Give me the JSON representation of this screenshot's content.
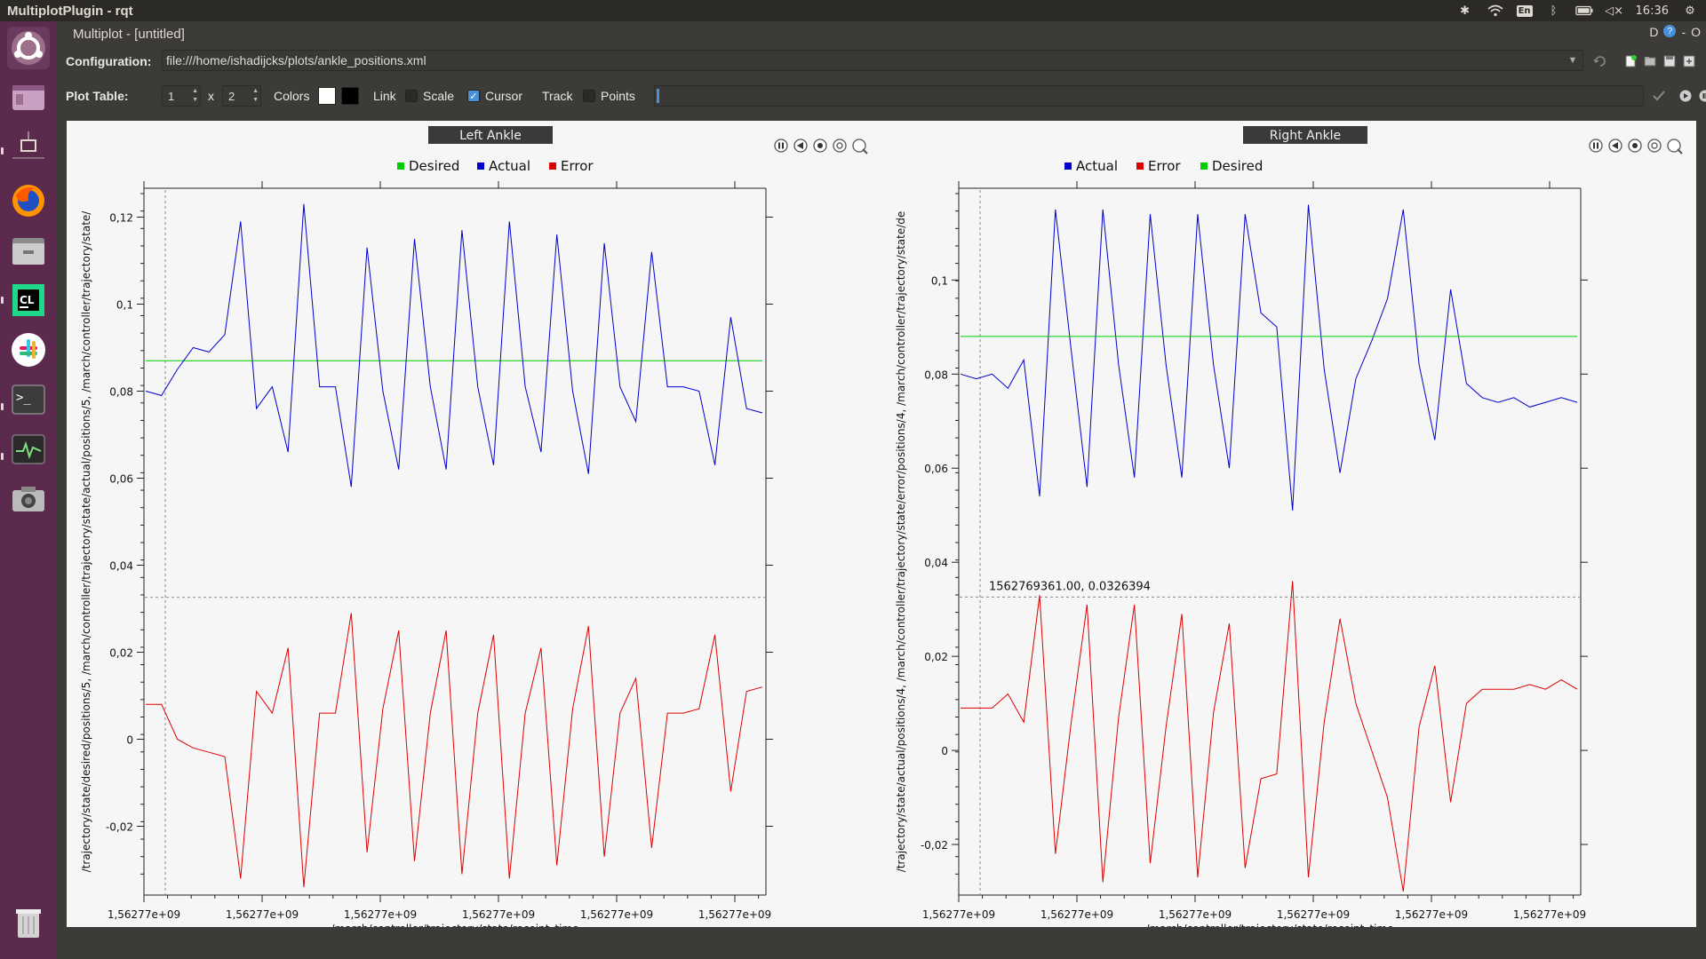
{
  "system": {
    "app_title": "MultiplotPlugin - rqt",
    "keyboard": "En",
    "clock": "16:36"
  },
  "window": {
    "title": "Multiplot - [untitled]",
    "ctrl_d": "D",
    "ctrl_help": "?",
    "ctrl_min": "-",
    "ctrl_close": "O"
  },
  "config": {
    "label": "Configuration:",
    "value": "file:///home/ishadijcks/plots/ankle_positions.xml"
  },
  "table_bar": {
    "label": "Plot Table:",
    "rows": "1",
    "x": "x",
    "cols": "2",
    "colors_label": "Colors",
    "bg_color": "#ffffff",
    "fg_color": "#000000",
    "link_label": "Link",
    "link_checked": false,
    "scale_label": "Scale",
    "scale_checked": false,
    "cursor_label": "Cursor",
    "cursor_checked": true,
    "track_label": "Track",
    "track_checked": false,
    "points_label": "Points",
    "points_checked": false
  },
  "launcher_icons": [
    "ubuntu-dash-icon",
    "workspace-icon",
    "settings-icon",
    "firefox-icon",
    "files-icon",
    "clion-icon",
    "slack-icon",
    "terminal-icon",
    "system-monitor-icon",
    "camera-icon",
    "trash-icon"
  ],
  "colors": {
    "actual": "#0000cc",
    "error": "#dd0000",
    "desired": "#00cc00",
    "plot_bg": "#f6f6f6",
    "launcher": "#5c2a4c"
  },
  "chart_data": [
    {
      "type": "line",
      "title": "Left Ankle",
      "legend": [
        "Desired",
        "Actual",
        "Error"
      ],
      "legend_colors": [
        "#00cc00",
        "#0000cc",
        "#dd0000"
      ],
      "xlabel": "/march/controller/trajectory/state/receipt_time",
      "ylabel": "/trajectory/state/desired/positions/5, /march/controller/trajectory/state/actual/positions/5, /march/controller/trajectory/state/",
      "xticks": [
        "1,56277e+09",
        "1,56277e+09",
        "1,56277e+09",
        "1,56277e+09",
        "1,56277e+09",
        "1,56277e+09"
      ],
      "yticks": [
        "0,12",
        "0,1",
        "0,08",
        "0,06",
        "0,04",
        "0,02",
        "0",
        "-0,02"
      ],
      "ylim": [
        -0.035,
        0.125
      ],
      "grid": false,
      "legend_position": "top",
      "series": [
        {
          "name": "Desired",
          "color": "#00cc00",
          "values": [
            0.087,
            0.087,
            0.087,
            0.087,
            0.087,
            0.087,
            0.087,
            0.087,
            0.087,
            0.087,
            0.087,
            0.087,
            0.087,
            0.087,
            0.087,
            0.087,
            0.087,
            0.087,
            0.087,
            0.087,
            0.087,
            0.087,
            0.087,
            0.087,
            0.087,
            0.087,
            0.087,
            0.087,
            0.087,
            0.087,
            0.087,
            0.087,
            0.087,
            0.087,
            0.087,
            0.087,
            0.087,
            0.087,
            0.087,
            0.087
          ]
        },
        {
          "name": "Actual",
          "color": "#0000cc",
          "values": [
            0.08,
            0.079,
            0.085,
            0.09,
            0.089,
            0.093,
            0.119,
            0.076,
            0.081,
            0.066,
            0.123,
            0.081,
            0.081,
            0.058,
            0.113,
            0.08,
            0.062,
            0.115,
            0.081,
            0.062,
            0.117,
            0.081,
            0.063,
            0.119,
            0.081,
            0.066,
            0.116,
            0.08,
            0.061,
            0.114,
            0.081,
            0.073,
            0.112,
            0.081,
            0.081,
            0.08,
            0.063,
            0.097,
            0.076,
            0.075
          ]
        },
        {
          "name": "Error",
          "color": "#dd0000",
          "values": [
            0.008,
            0.008,
            0.0,
            -0.002,
            -0.003,
            -0.004,
            -0.032,
            0.011,
            0.006,
            0.021,
            -0.034,
            0.006,
            0.006,
            0.029,
            -0.026,
            0.007,
            0.025,
            -0.028,
            0.006,
            0.025,
            -0.031,
            0.006,
            0.024,
            -0.032,
            0.006,
            0.021,
            -0.029,
            0.007,
            0.026,
            -0.027,
            0.006,
            0.014,
            -0.025,
            0.006,
            0.006,
            0.007,
            0.024,
            -0.012,
            0.011,
            0.012
          ]
        }
      ]
    },
    {
      "type": "line",
      "title": "Right Ankle",
      "legend": [
        "Actual",
        "Error",
        "Desired"
      ],
      "legend_colors": [
        "#0000cc",
        "#dd0000",
        "#00cc00"
      ],
      "xlabel": "/march/controller/trajectory/state/receipt_time",
      "ylabel": "/trajectory/state/actual/positions/4, /march/controller/trajectory/state/error/positions/4, /march/controller/trajectory/state/de",
      "xticks": [
        "1,56277e+09",
        "1,56277e+09",
        "1,56277e+09",
        "1,56277e+09",
        "1,56277e+09",
        "1,56277e+09"
      ],
      "yticks": [
        "0,1",
        "0,08",
        "0,06",
        "0,04",
        "0,02",
        "0",
        "-0,02"
      ],
      "ylim": [
        -0.03,
        0.118
      ],
      "grid": false,
      "legend_position": "top",
      "cursor_label": "1562769361.00, 0.0326394",
      "series": [
        {
          "name": "Actual",
          "color": "#0000cc",
          "values": [
            0.08,
            0.079,
            0.08,
            0.077,
            0.083,
            0.054,
            0.115,
            0.085,
            0.056,
            0.115,
            0.082,
            0.058,
            0.114,
            0.082,
            0.058,
            0.114,
            0.082,
            0.06,
            0.114,
            0.093,
            0.09,
            0.051,
            0.116,
            0.081,
            0.059,
            0.079,
            0.087,
            0.096,
            0.115,
            0.082,
            0.066,
            0.098,
            0.078,
            0.075,
            0.074,
            0.075,
            0.073,
            0.074,
            0.075,
            0.074
          ]
        },
        {
          "name": "Error",
          "color": "#dd0000",
          "values": [
            0.009,
            0.009,
            0.009,
            0.012,
            0.006,
            0.033,
            -0.022,
            0.006,
            0.031,
            -0.028,
            0.007,
            0.031,
            -0.024,
            0.005,
            0.029,
            -0.027,
            0.008,
            0.027,
            -0.025,
            -0.006,
            -0.005,
            0.036,
            -0.027,
            0.006,
            0.028,
            0.01,
            0.0,
            -0.01,
            -0.03,
            0.005,
            0.018,
            -0.011,
            0.01,
            0.013,
            0.013,
            0.013,
            0.014,
            0.013,
            0.015,
            0.013
          ]
        },
        {
          "name": "Desired",
          "color": "#00cc00",
          "values": [
            0.088,
            0.088,
            0.088,
            0.088,
            0.088,
            0.088,
            0.088,
            0.088,
            0.088,
            0.088,
            0.088,
            0.088,
            0.088,
            0.088,
            0.088,
            0.088,
            0.088,
            0.088,
            0.088,
            0.088,
            0.088,
            0.088,
            0.088,
            0.088,
            0.088,
            0.088,
            0.088,
            0.088,
            0.088,
            0.088,
            0.088,
            0.088,
            0.088,
            0.088,
            0.088,
            0.088,
            0.088,
            0.088,
            0.088,
            0.088
          ]
        }
      ]
    }
  ]
}
